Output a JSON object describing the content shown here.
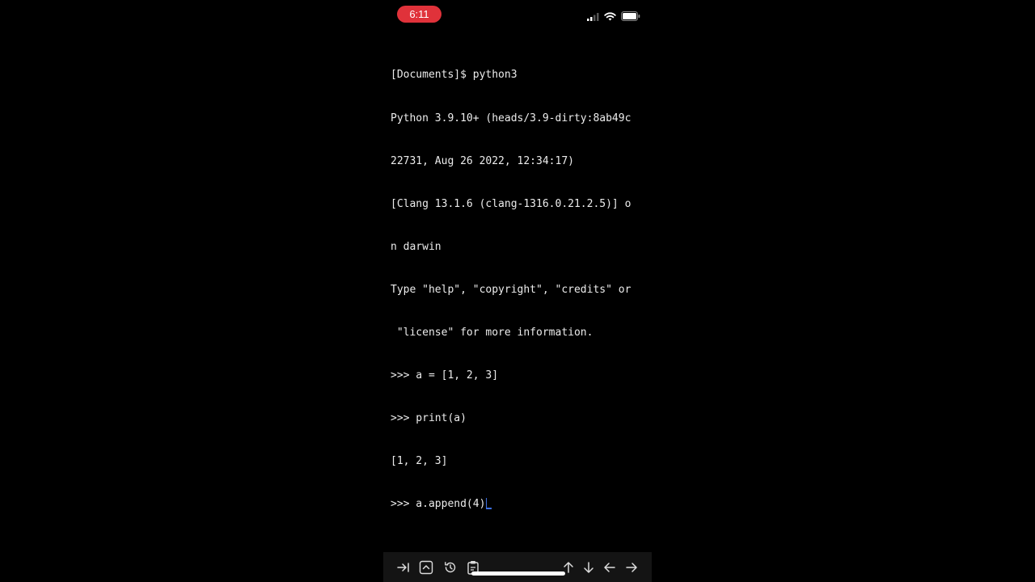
{
  "status_bar": {
    "time": "6:11",
    "time_pill_color": "#e0323a",
    "icons": [
      "cellular-signal-icon",
      "wifi-icon",
      "battery-icon"
    ]
  },
  "terminal": {
    "cursor_color": "#3d6fe0",
    "lines": [
      "[Documents]$ python3",
      "Python 3.9.10+ (heads/3.9-dirty:8ab49c",
      "22731, Aug 26 2022, 12:34:17)",
      "[Clang 13.1.6 (clang-1316.0.21.2.5)] o",
      "n darwin",
      "Type \"help\", \"copyright\", \"credits\" or",
      " \"license\" for more information.",
      ">>> a = [1, 2, 3]",
      ">>> print(a)",
      "[1, 2, 3]",
      ">>> a.append(4)"
    ]
  },
  "toolbar": {
    "buttons": [
      "tab-key-icon",
      "control-key-icon",
      "history-icon",
      "paste-icon",
      "arrow-up-icon",
      "arrow-down-icon",
      "arrow-left-icon",
      "arrow-right-icon"
    ]
  }
}
